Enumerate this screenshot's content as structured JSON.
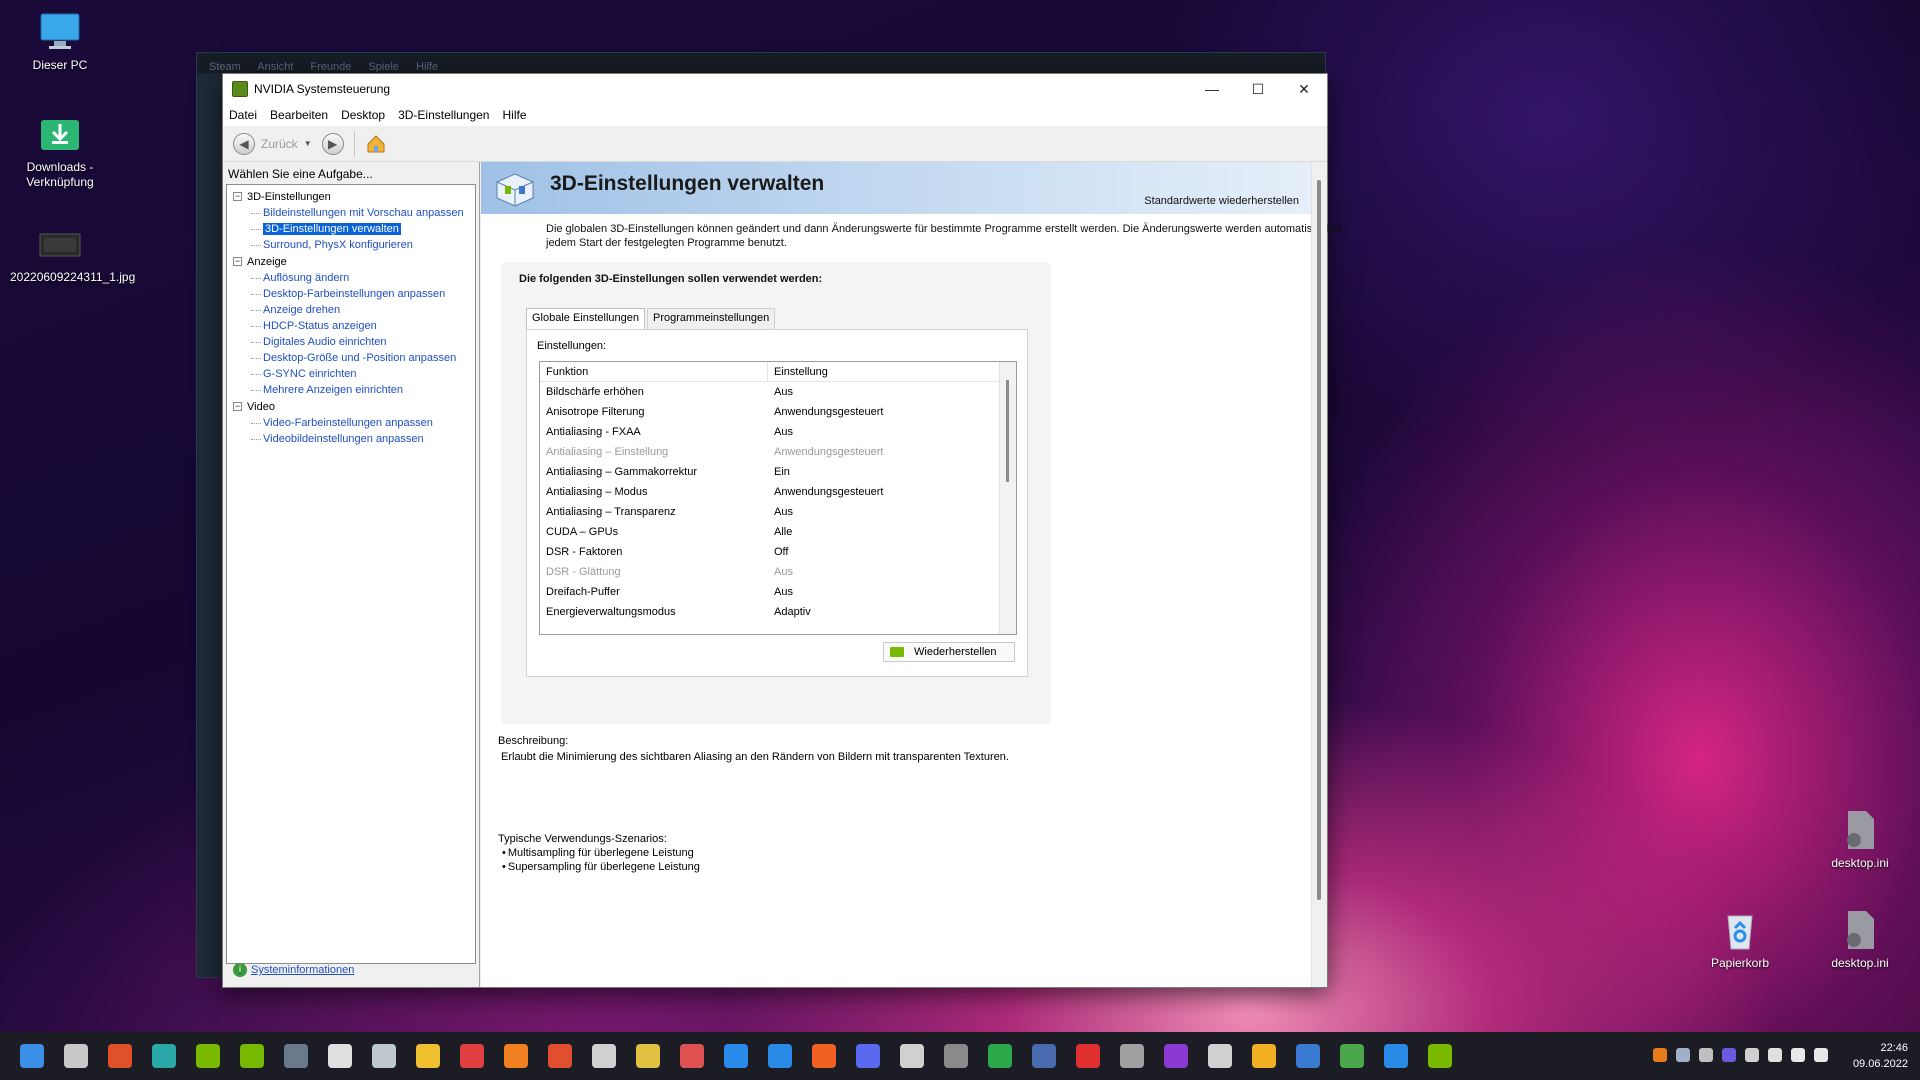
{
  "desktop": {
    "icons_left": [
      {
        "label": "Dieser PC",
        "icon": "monitor-icon"
      },
      {
        "label": "Downloads - Verknüpfung",
        "icon": "downloads-folder-icon"
      },
      {
        "label": "20220609224311_1.jpg",
        "icon": "image-file-icon"
      }
    ],
    "icons_right": [
      {
        "label": "desktop.ini",
        "icon": "settings-file-icon"
      },
      {
        "label": "Papierkorb",
        "icon": "recycle-bin-icon"
      },
      {
        "label": "desktop.ini",
        "icon": "settings-file-icon"
      }
    ]
  },
  "background_window": {
    "menu": [
      "Steam",
      "Ansicht",
      "Freunde",
      "Spiele",
      "Hilfe"
    ]
  },
  "window": {
    "title": "NVIDIA Systemsteuerung",
    "menu": [
      "Datei",
      "Bearbeiten",
      "Desktop",
      "3D-Einstellungen",
      "Hilfe"
    ],
    "toolbar": {
      "back_label": "Zurück"
    },
    "left": {
      "task_label": "Wählen Sie eine Aufgabe...",
      "groups": [
        {
          "label": "3D-Einstellungen",
          "items": [
            "Bildeinstellungen mit Vorschau anpassen",
            "3D-Einstellungen verwalten",
            "Surround, PhysX konfigurieren"
          ]
        },
        {
          "label": "Anzeige",
          "items": [
            "Auflösung ändern",
            "Desktop-Farbeinstellungen anpassen",
            "Anzeige drehen",
            "HDCP-Status anzeigen",
            "Digitales Audio einrichten",
            "Desktop-Größe und -Position anpassen",
            "G-SYNC einrichten",
            "Mehrere Anzeigen einrichten"
          ]
        },
        {
          "label": "Video",
          "items": [
            "Video-Farbeinstellungen anpassen",
            "Videobildeinstellungen anpassen"
          ]
        }
      ],
      "selected_item": "3D-Einstellungen verwalten",
      "sysinfo": "Systeminformationen"
    },
    "right": {
      "title": "3D-Einstellungen verwalten",
      "restore_defaults": "Standardwerte wiederherstellen",
      "intro": "Die globalen 3D-Einstellungen können geändert und dann Änderungswerte für bestimmte Programme erstellt werden. Die Änderungswerte werden automatisch bei jedem Start der festgelegten Programme benutzt.",
      "settings_title": "Die folgenden 3D-Einstellungen sollen verwendet werden:",
      "tabs": [
        "Globale Einstellungen",
        "Programmeinstellungen"
      ],
      "settings_label": "Einstellungen:",
      "columns": [
        "Funktion",
        "Einstellung"
      ],
      "rows": [
        {
          "f": "Bildschärfe erhöhen",
          "v": "Aus",
          "disabled": false
        },
        {
          "f": "Anisotrope Filterung",
          "v": "Anwendungsgesteuert",
          "disabled": false
        },
        {
          "f": "Antialiasing - FXAA",
          "v": "Aus",
          "disabled": false
        },
        {
          "f": "Antialiasing – Einstellung",
          "v": "Anwendungsgesteuert",
          "disabled": true
        },
        {
          "f": "Antialiasing – Gammakorrektur",
          "v": "Ein",
          "disabled": false
        },
        {
          "f": "Antialiasing – Modus",
          "v": "Anwendungsgesteuert",
          "disabled": false
        },
        {
          "f": "Antialiasing – Transparenz",
          "v": "Aus",
          "disabled": false
        },
        {
          "f": "CUDA – GPUs",
          "v": "Alle",
          "disabled": false
        },
        {
          "f": "DSR - Faktoren",
          "v": "Off",
          "disabled": false
        },
        {
          "f": "DSR - Glättung",
          "v": "Aus",
          "disabled": true
        },
        {
          "f": "Dreifach-Puffer",
          "v": "Aus",
          "disabled": false
        },
        {
          "f": "Energieverwaltungsmodus",
          "v": "Adaptiv",
          "disabled": false
        }
      ],
      "restore_button": "Wiederherstellen",
      "description_label": "Beschreibung:",
      "description": "Erlaubt die Minimierung des sichtbaren Aliasing an den Rändern von Bildern mit transparenten Texturen.",
      "usage_label": "Typische Verwendungs-Szenarios:",
      "usage": [
        "Multisampling für überlegene Leistung",
        "Supersampling für überlegene Leistung"
      ]
    }
  },
  "taskbar": {
    "time": "22:46",
    "date": "09.06.2022"
  }
}
